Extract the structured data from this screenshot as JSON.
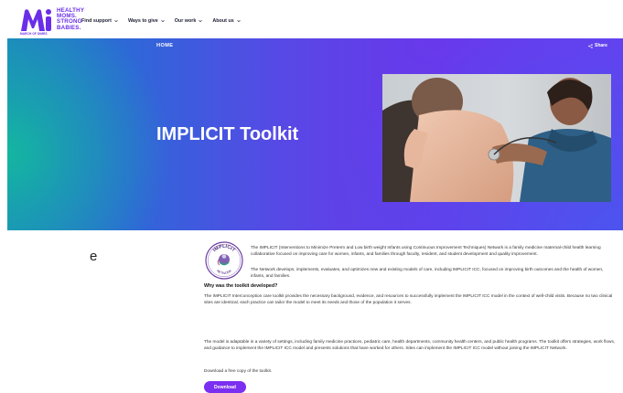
{
  "logo": {
    "lines": [
      "HEALTHY",
      "MOMS.",
      "STRONG",
      "BABIES."
    ],
    "caption": "MARCH OF DIMES",
    "brand_color": "#6a2ee8"
  },
  "nav": {
    "items": [
      {
        "label": "Find support"
      },
      {
        "label": "Ways to give"
      },
      {
        "label": "Our work"
      },
      {
        "label": "About us"
      }
    ]
  },
  "hero": {
    "breadcrumb": "HOME",
    "share_label": "Share",
    "title": "IMPLICIT Toolkit"
  },
  "badge": {
    "top_text": "IMPLICIT",
    "bottom_text": "NETWORK"
  },
  "content": {
    "intro": "The IMPLICIT (Interventions to Minimize Preterm and Low birth weight Infants using Continuous Improvement Techniques) Network is a family medicine maternal-child health learning collaborative focused on improving care for women, infants, and families through faculty, resident, and student development and quality improvement.",
    "intro_prefix": "The IMPLICIT (",
    "network_text": "The Network develops, implements, evaluates, and optimizes new and existing models of care, including IMPLICIT ICC, focused on improving birth outcomes and the health of women, infants, and families.",
    "why_heading": "Why was the toolkit developed?",
    "why_text": "The IMPLICIT Interconception care toolkit provides the necessary background, evidence, and resources to successfully implement the IMPLICIT ICC model in the context of well-child visits. Because no two clinical sites are identical, each practice can tailor the model to meet its needs and those of the population it serves.",
    "model_text": "The model is adaptable in a variety of settings, including family medicine practices, pediatric care, health departments, community health centers, and public health programs. The toolkit offers strategies, work flows, and guidance to implement the IMPLICIT ICC model and presents solutions that have worked for others. Sites can implement the IMPLICIT ICC model without joining the IMPLICIT Network.",
    "download_text": "Download a free copy of the toolkit.",
    "download_button": "Download"
  },
  "side_text": "e",
  "colors": {
    "accent": "#7b2ff0",
    "hero_teal": "#14b6a0",
    "hero_purple": "#6b3cf0"
  }
}
